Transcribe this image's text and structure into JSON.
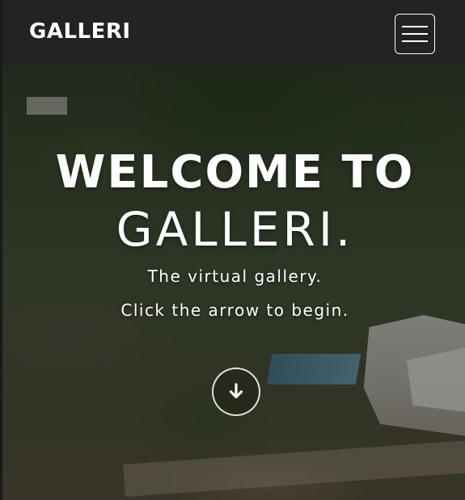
{
  "navbar": {
    "brand": "GALLERI",
    "menu_icon": "hamburger-menu-icon"
  },
  "hero": {
    "title_line1": "WELCOME TO",
    "title_line2": "GALLERI.",
    "subtitle": "The virtual gallery.",
    "cta_text": "Click the arrow to begin.",
    "arrow_icon": "arrow-down-icon"
  },
  "colors": {
    "navbar_bg": "#232323",
    "text": "#ffffff"
  }
}
